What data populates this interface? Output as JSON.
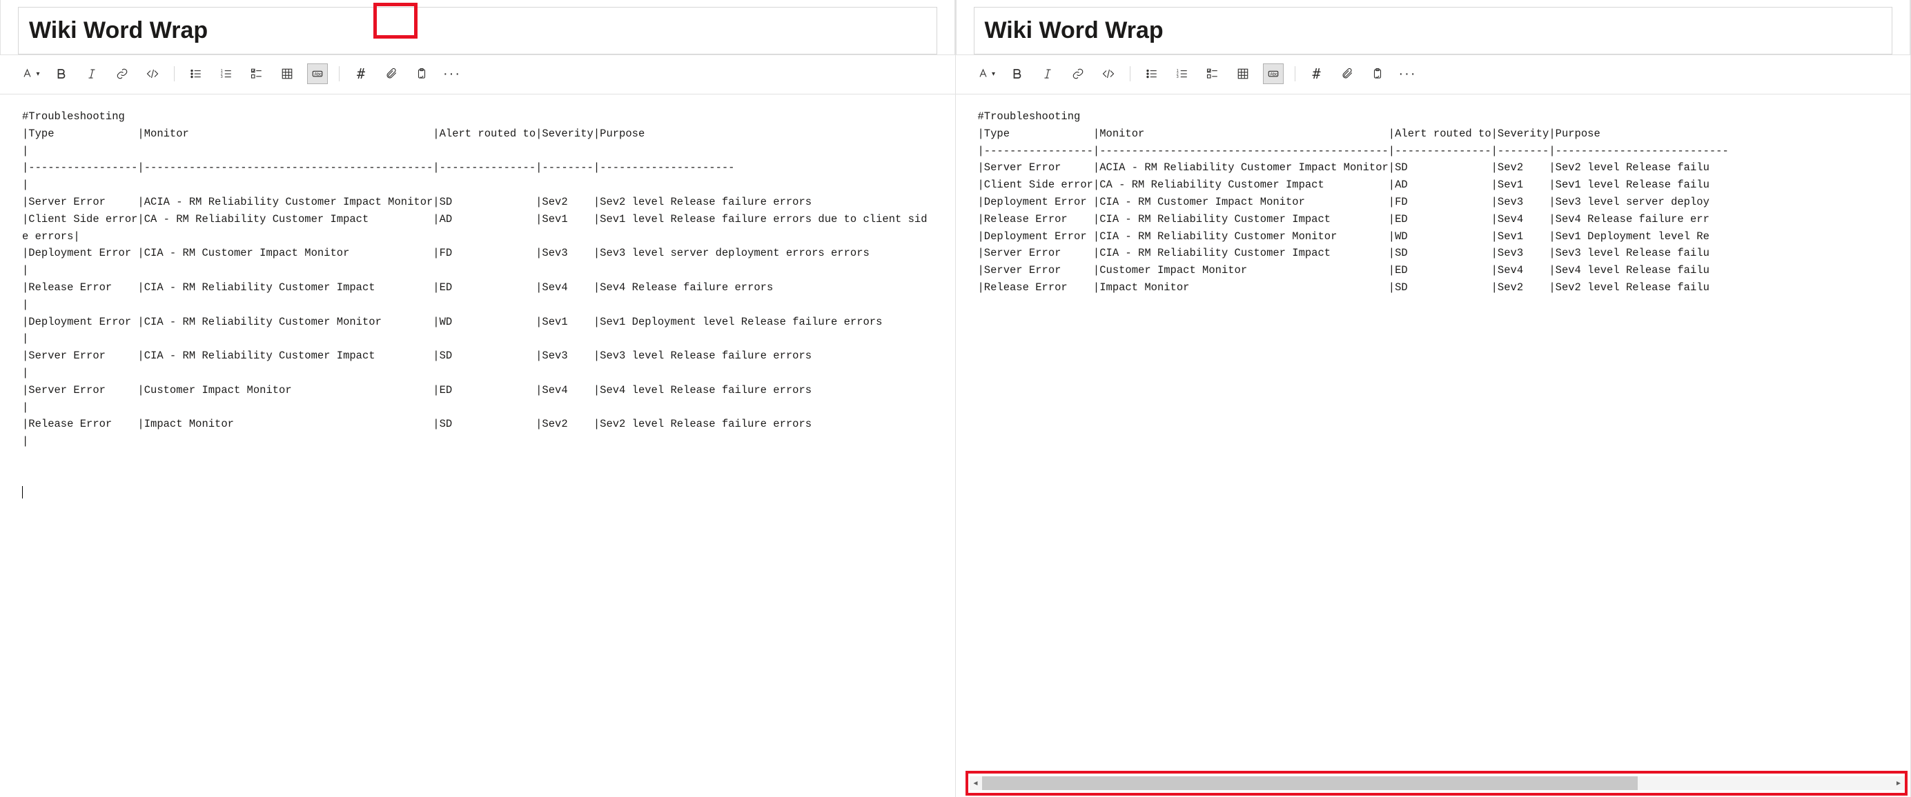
{
  "title": "Wiki Word Wrap",
  "toolbar": {
    "text_format": "Text format",
    "bold": "Bold",
    "italic": "Italic",
    "link": "Link",
    "code": "Code",
    "bulleted": "Bulleted list",
    "numbered": "Numbered list",
    "checklist": "Checklist",
    "table": "Table",
    "wrap": "Word wrap",
    "hash": "#",
    "attach": "Attach",
    "paste": "Paste",
    "more": "···"
  },
  "left_content": "#Troubleshooting\n|Type             |Monitor                                      |Alert routed to|Severity|Purpose\n|\n|-----------------|---------------------------------------------|---------------|--------|---------------------\n|\n|Server Error     |ACIA - RM Reliability Customer Impact Monitor|SD             |Sev2    |Sev2 level Release failure errors\n|Client Side error|CA - RM Reliability Customer Impact          |AD             |Sev1    |Sev1 level Release failure errors due to client side errors|\n|Deployment Error |CIA - RM Customer Impact Monitor             |FD             |Sev3    |Sev3 level server deployment errors errors               |\n|Release Error    |CIA - RM Reliability Customer Impact         |ED             |Sev4    |Sev4 Release failure errors                                |\n|Deployment Error |CIA - RM Reliability Customer Monitor        |WD             |Sev1    |Sev1 Deployment level Release failure errors               |\n|Server Error     |CIA - RM Reliability Customer Impact         |SD             |Sev3    |Sev3 level Release failure errors                          |\n|Server Error     |Customer Impact Monitor                      |ED             |Sev4    |Sev4 level Release failure errors                          |\n|Release Error    |Impact Monitor                               |SD             |Sev2    |Sev2 level Release failure errors                          |\n\n\n",
  "right_content": "#Troubleshooting\n|Type             |Monitor                                      |Alert routed to|Severity|Purpose\n|-----------------|---------------------------------------------|---------------|--------|---------------------------\n|Server Error     |ACIA - RM Reliability Customer Impact Monitor|SD             |Sev2    |Sev2 level Release failu\n|Client Side error|CA - RM Reliability Customer Impact          |AD             |Sev1    |Sev1 level Release failu\n|Deployment Error |CIA - RM Customer Impact Monitor             |FD             |Sev3    |Sev3 level server deploy\n|Release Error    |CIA - RM Reliability Customer Impact         |ED             |Sev4    |Sev4 Release failure err\n|Deployment Error |CIA - RM Reliability Customer Monitor        |WD             |Sev1    |Sev1 Deployment level Re\n|Server Error     |CIA - RM Reliability Customer Impact         |SD             |Sev3    |Sev3 level Release failu\n|Server Error     |Customer Impact Monitor                      |ED             |Sev4    |Sev4 level Release failu\n|Release Error    |Impact Monitor                               |SD             |Sev2    |Sev2 level Release failu"
}
